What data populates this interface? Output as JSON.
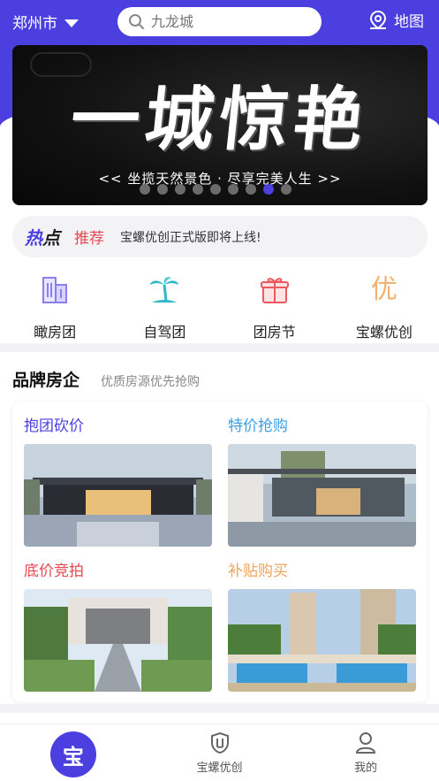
{
  "header": {
    "city": "郑州市",
    "search_placeholder": "九龙城",
    "map_label": "地图"
  },
  "banner": {
    "title": "一城惊艳",
    "subtitle": "<< 坐揽天然景色 · 尽享完美人生 >>",
    "slide_count": 9,
    "active_slide": 8
  },
  "notice": {
    "hot_a": "热",
    "hot_b": "点",
    "tag": "推荐",
    "text": "宝螺优创正式版即将上线!"
  },
  "categories": [
    {
      "label": "瞰房团",
      "icon": "building-icon"
    },
    {
      "label": "自驾团",
      "icon": "palm-tree-icon"
    },
    {
      "label": "团房节",
      "icon": "gift-icon"
    },
    {
      "label": "宝螺优创",
      "icon": "you-badge-icon",
      "glyph": "优"
    }
  ],
  "brand_section": {
    "title": "品牌房企",
    "subtitle": "优质房源优先抢购",
    "tiles": [
      {
        "label": "抱团砍价",
        "color": "#4b3fe0"
      },
      {
        "label": "特价抢购",
        "color": "#3aa0e6"
      },
      {
        "label": "底价竞拍",
        "color": "#e8474f"
      },
      {
        "label": "补贴购买",
        "color": "#f0a35b"
      }
    ]
  },
  "tabbar": {
    "home_glyph": "宝",
    "items": [
      {
        "label": ""
      },
      {
        "label": "宝螺优创"
      },
      {
        "label": "我的"
      }
    ]
  },
  "colors": {
    "primary": "#4b3fe0",
    "hot_red": "#e8474f"
  }
}
